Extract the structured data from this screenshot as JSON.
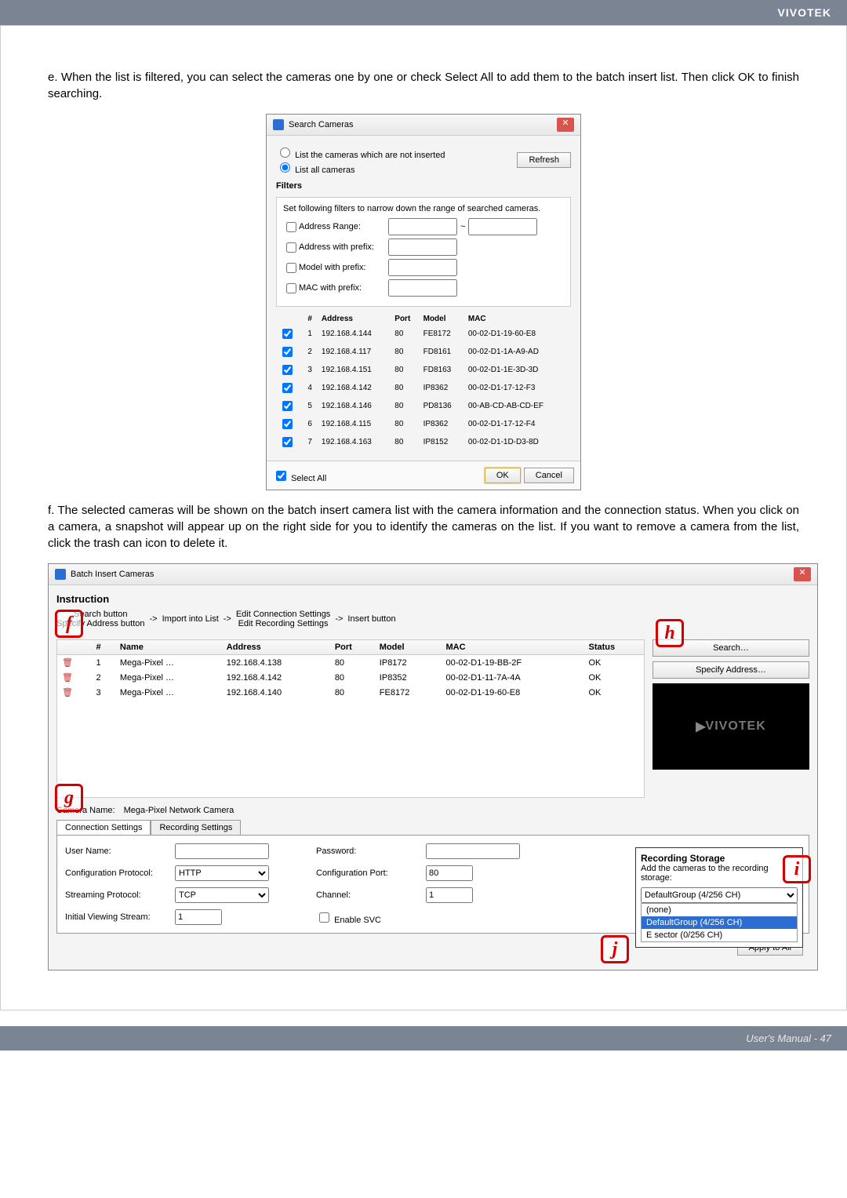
{
  "header": {
    "brand": "VIVOTEK"
  },
  "para_e": "e. When the list is filtered, you can select the cameras one by one or check Select All to add them to the batch insert list. Then click OK to finish searching.",
  "para_f": "f. The selected cameras will be shown on the batch insert camera list with the camera information and the connection status. When you click on a camera, a snapshot will appear up on the right side for you to identify the cameras on the list. If you want to remove a camera from the list, click the trash can icon to delete it.",
  "searchDialog": {
    "title": "Search Cameras",
    "opt1": "List the cameras which are not inserted",
    "opt2": "List all cameras",
    "refresh": "Refresh",
    "filtersTitle": "Filters",
    "filtersHint": "Set following filters to narrow down the range of searched cameras.",
    "f_addrRange": "Address Range:",
    "f_addrPrefix": "Address with prefix:",
    "f_modelPrefix": "Model with prefix:",
    "f_macPrefix": "MAC with prefix:",
    "tilde": "~",
    "th_num": "#",
    "th_addr": "Address",
    "th_port": "Port",
    "th_model": "Model",
    "th_mac": "MAC",
    "rows": [
      {
        "n": "1",
        "addr": "192.168.4.144",
        "port": "80",
        "model": "FE8172",
        "mac": "00-02-D1-19-60-E8"
      },
      {
        "n": "2",
        "addr": "192.168.4.117",
        "port": "80",
        "model": "FD8161",
        "mac": "00-02-D1-1A-A9-AD"
      },
      {
        "n": "3",
        "addr": "192.168.4.151",
        "port": "80",
        "model": "FD8163",
        "mac": "00-02-D1-1E-3D-3D"
      },
      {
        "n": "4",
        "addr": "192.168.4.142",
        "port": "80",
        "model": "IP8362",
        "mac": "00-02-D1-17-12-F3"
      },
      {
        "n": "5",
        "addr": "192.168.4.146",
        "port": "80",
        "model": "PD8136",
        "mac": "00-AB-CD-AB-CD-EF"
      },
      {
        "n": "6",
        "addr": "192.168.4.115",
        "port": "80",
        "model": "IP8362",
        "mac": "00-02-D1-17-12-F4"
      },
      {
        "n": "7",
        "addr": "192.168.4.163",
        "port": "80",
        "model": "IP8152",
        "mac": "00-02-D1-1D-D3-8D"
      }
    ],
    "selectAll": "Select All",
    "ok": "OK",
    "cancel": "Cancel"
  },
  "batchDialog": {
    "title": "Batch Insert Cameras",
    "instrTitle": "Instruction",
    "flow": {
      "c1a": "Search button",
      "c1b": "Specify Address button",
      "arrow": "->",
      "c2": "Import into List",
      "c3a": "Edit Connection Settings",
      "c3b": "Edit Recording Settings",
      "c4": "Insert button"
    },
    "th_num": "#",
    "th_name": "Name",
    "th_addr": "Address",
    "th_port": "Port",
    "th_model": "Model",
    "th_mac": "MAC",
    "th_status": "Status",
    "rows": [
      {
        "n": "1",
        "name": "Mega-Pixel …",
        "addr": "192.168.4.138",
        "port": "80",
        "model": "IP8172",
        "mac": "00-02-D1-19-BB-2F",
        "status": "OK"
      },
      {
        "n": "2",
        "name": "Mega-Pixel …",
        "addr": "192.168.4.142",
        "port": "80",
        "model": "IP8352",
        "mac": "00-02-D1-11-7A-4A",
        "status": "OK"
      },
      {
        "n": "3",
        "name": "Mega-Pixel …",
        "addr": "192.168.4.140",
        "port": "80",
        "model": "FE8172",
        "mac": "00-02-D1-19-60-E8",
        "status": "OK"
      }
    ],
    "searchBtn": "Search…",
    "specifyBtn": "Specify Address…",
    "previewText": "VIVOTEK",
    "camNameLabel": "Camera Name:",
    "camNameValue": "Mega-Pixel Network Camera",
    "tab1": "Connection Settings",
    "tab2": "Recording Settings",
    "form": {
      "userName": "User Name:",
      "password": "Password:",
      "confProto": "Configuration Protocol:",
      "confProtoVal": "HTTP",
      "confPort": "Configuration Port:",
      "confPortVal": "80",
      "streamProto": "Streaming Protocol:",
      "streamProtoVal": "TCP",
      "channel": "Channel:",
      "channelVal": "1",
      "initStream": "Initial Viewing Stream:",
      "initStreamVal": "1",
      "enableSVC": "Enable SVC",
      "applyAll": "Apply to All"
    },
    "storage": {
      "title": "Recording Storage",
      "hint": "Add the cameras to the recording storage:",
      "selected": "DefaultGroup (4/256 CH)",
      "opts": [
        "(none)",
        "DefaultGroup (4/256 CH)",
        "E sector (0/256 CH)"
      ]
    }
  },
  "labels": {
    "f": "f",
    "g": "g",
    "h": "h",
    "i": "i",
    "j": "j"
  },
  "footer": "User's Manual - 47"
}
